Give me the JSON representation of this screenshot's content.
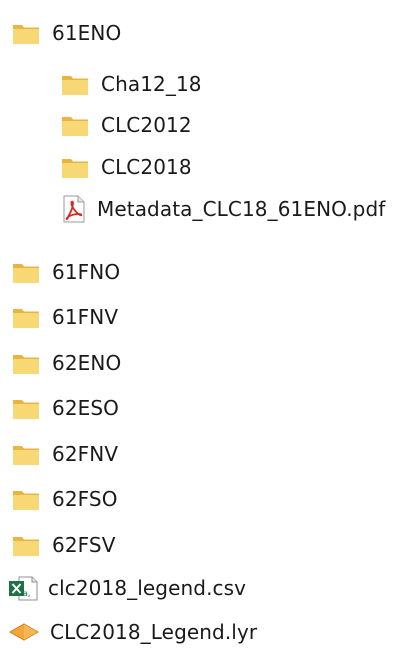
{
  "items": [
    {
      "label": "61ENO",
      "icon": "folder-icon"
    },
    {
      "label": "Cha12_18",
      "icon": "folder-icon"
    },
    {
      "label": "CLC2012",
      "icon": "folder-icon"
    },
    {
      "label": "CLC2018",
      "icon": "folder-icon"
    },
    {
      "label": "Metadata_CLC18_61ENO.pdf",
      "icon": "pdf-icon"
    },
    {
      "label": "61FNO",
      "icon": "folder-icon"
    },
    {
      "label": "61FNV",
      "icon": "folder-icon"
    },
    {
      "label": "62ENO",
      "icon": "folder-icon"
    },
    {
      "label": "62ESO",
      "icon": "folder-icon"
    },
    {
      "label": "62FNV",
      "icon": "folder-icon"
    },
    {
      "label": "62FSO",
      "icon": "folder-icon"
    },
    {
      "label": "62FSV",
      "icon": "folder-icon"
    },
    {
      "label": "clc2018_legend.csv",
      "icon": "excel-csv-icon"
    },
    {
      "label": "CLC2018_Legend.lyr",
      "icon": "layer-file-icon"
    }
  ],
  "colors": {
    "folder_body": "#F8D775",
    "folder_tab": "#E8B640",
    "pdf_red": "#D9281E",
    "excel_green": "#1E7145",
    "layer_orange": "#F2A73B",
    "text": "#1A1A1A"
  }
}
